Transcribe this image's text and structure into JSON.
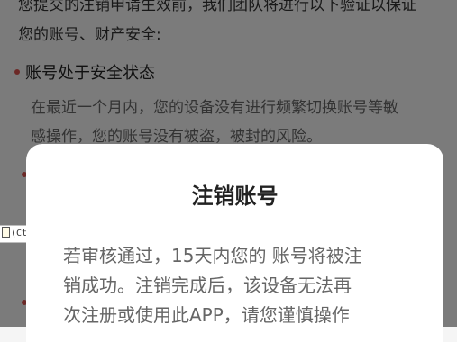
{
  "intro": {
    "line1": "您提交的注销申请生效前，我们团队将进行以下验证以保证",
    "line2": "您的账号、财产安全:"
  },
  "section": {
    "heading": "账号处于安全状态",
    "body_line1": "在最近一个月内，您的设备没有进行频繁切换账号等敏",
    "body_line2": "感操作，您的账号没有被盗，被封的风险。"
  },
  "ctrl_chip": {
    "label": "(Ctrl)",
    "arrow": "▾"
  },
  "dialog": {
    "title": "注销账号",
    "body_line1": "若审核通过，15天内您的 账号将被注",
    "body_line2": "销成功。注销完成后，该设备无法再",
    "body_line3": "次注册或使用此APP，请您谨慎操作"
  },
  "colors": {
    "bullet": "#d9534f",
    "overlay": "rgba(0,0,0,0.5)",
    "dialog_bg": "#ffffff"
  }
}
